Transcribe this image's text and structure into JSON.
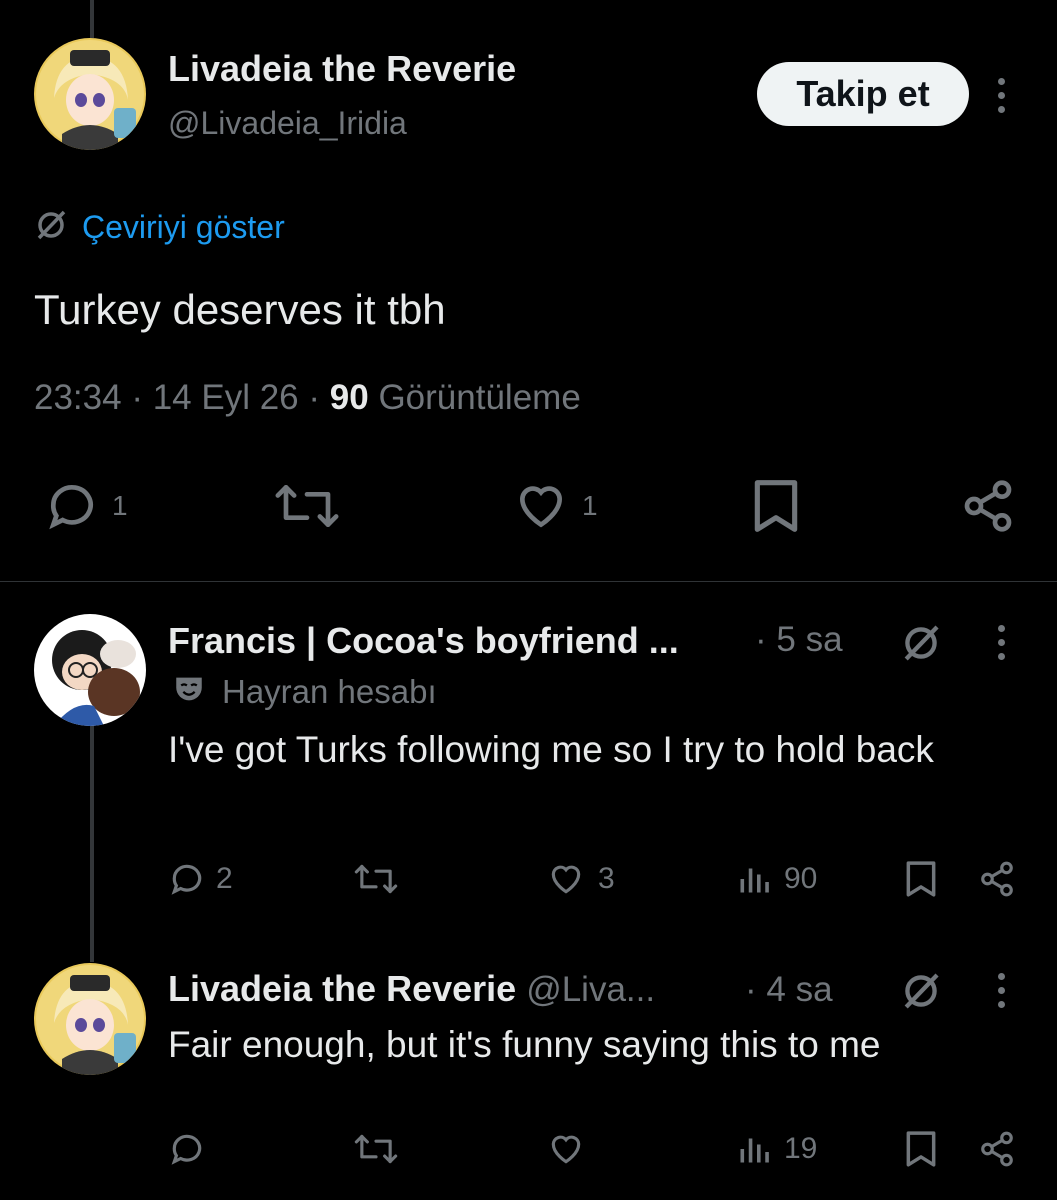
{
  "main_post": {
    "author_name": "Livadeia the Reverie",
    "author_handle": "@Livadeia_Iridia",
    "follow_label": "Takip et",
    "translate_label": "Çeviriyi göster",
    "text": "Turkey deserves it tbh",
    "time": "23:34",
    "separator": "·",
    "date": "14 Eyl 26",
    "views_count": "90",
    "views_label": "Görüntüleme",
    "replies": "1",
    "likes": "1"
  },
  "replies": [
    {
      "author_name": "Francis | Cocoa's boyfriend ...",
      "author_handle": "",
      "time": "· 5 sa",
      "badge_label": "Hayran hesabı",
      "text": "I've got Turks following me so I try to hold back",
      "reply_count": "2",
      "like_count": "3",
      "views": "90"
    },
    {
      "author_name": "Livadeia the Reverie",
      "author_handle": "@Liva...",
      "time": "· 4 sa",
      "text": "Fair enough, but it's funny saying this to me",
      "views": "19"
    }
  ],
  "colors": {
    "background": "#000000",
    "text": "#e7e9ea",
    "muted": "#71767b",
    "link": "#1d9bf0",
    "button_bg": "#eff3f4"
  },
  "icons": [
    "reply-icon",
    "repost-icon",
    "like-icon",
    "bookmark-icon",
    "share-icon",
    "views-icon",
    "no-translate-icon",
    "fan-account-mask-icon",
    "more-icon"
  ]
}
